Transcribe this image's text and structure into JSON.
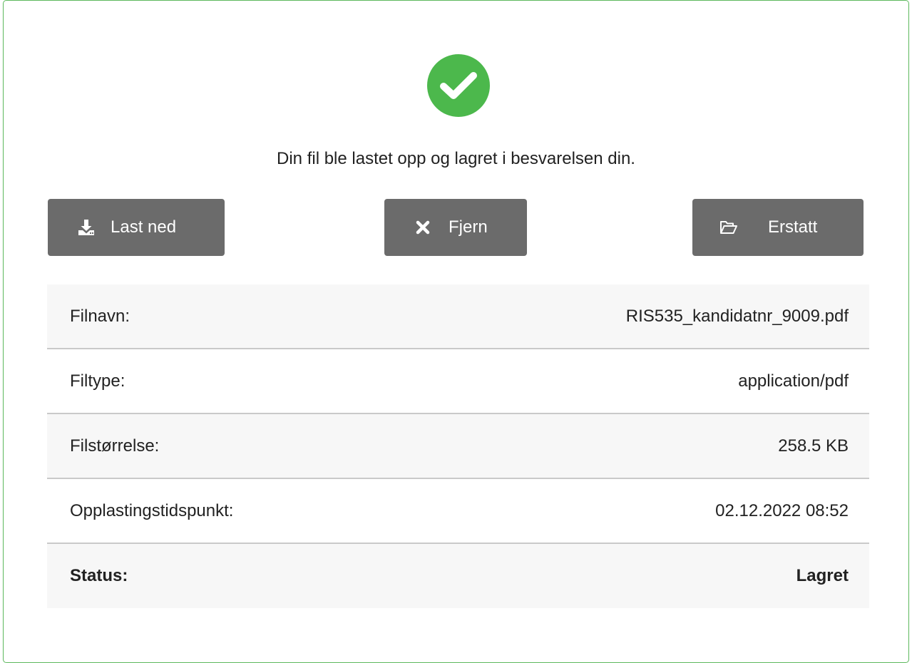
{
  "message": "Din fil ble lastet opp og lagret i besvarelsen din.",
  "colors": {
    "success": "#4cb84c",
    "panel_border": "#5cb85c",
    "button_bg": "#6b6b6b"
  },
  "icons": {
    "status": "check-circle-icon",
    "download": "download-icon",
    "remove": "times-icon",
    "replace": "folder-open-icon"
  },
  "actions": {
    "download_label": "Last ned",
    "remove_label": "Fjern",
    "replace_label": "Erstatt"
  },
  "file_info": [
    {
      "label": "Filnavn:",
      "value": "RIS535_kandidatnr_9009.pdf"
    },
    {
      "label": "Filtype:",
      "value": "application/pdf"
    },
    {
      "label": "Filstørrelse:",
      "value": "258.5 KB"
    },
    {
      "label": "Opplastingstidspunkt:",
      "value": "02.12.2022 08:52"
    },
    {
      "label": "Status:",
      "value": "Lagret"
    }
  ]
}
